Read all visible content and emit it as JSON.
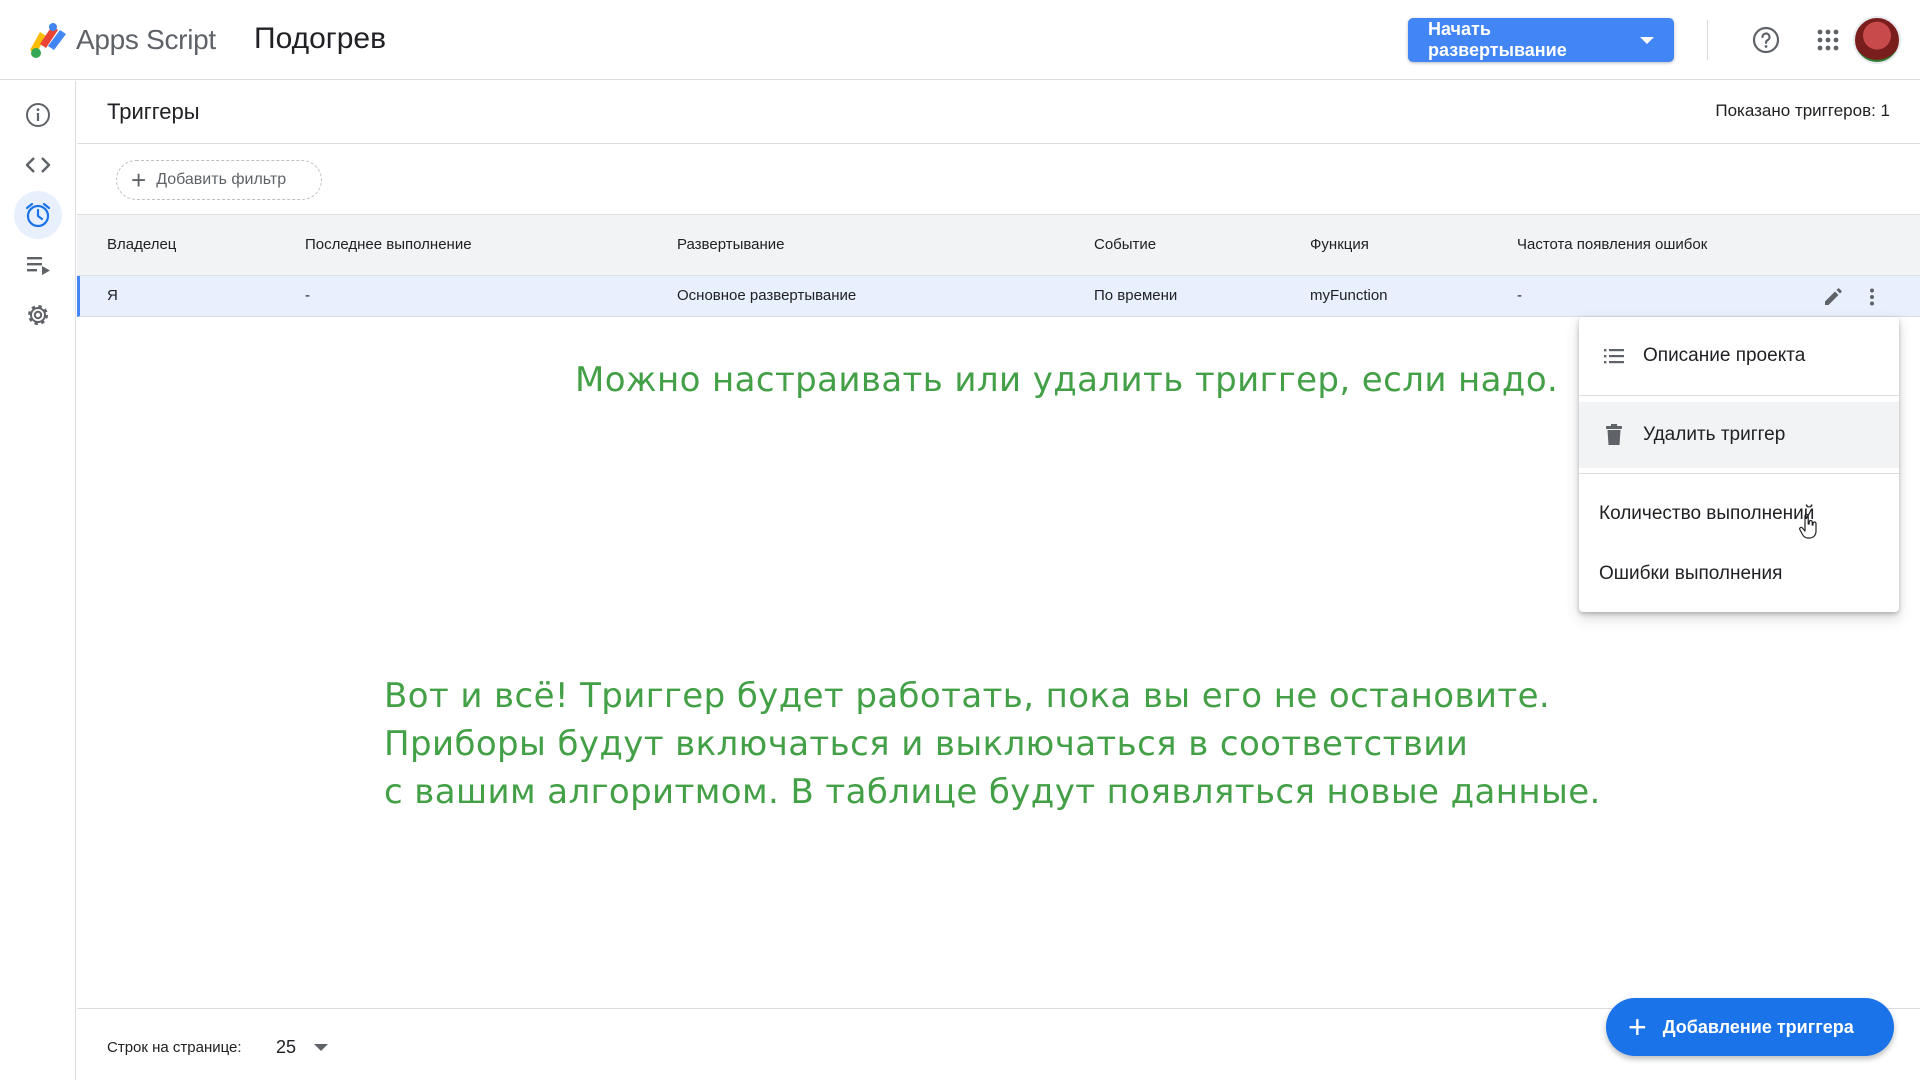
{
  "header": {
    "app_name": "Apps Script",
    "project_name": "Подогрев",
    "deploy_button": "Начать развертывание"
  },
  "rail": {
    "items": [
      "info-icon",
      "code-icon",
      "alarm-icon",
      "executions-icon",
      "settings-icon"
    ],
    "active": "alarm-icon"
  },
  "page": {
    "title": "Триггеры",
    "shown_count": "Показано триггеров: 1",
    "add_filter": "Добавить фильтр"
  },
  "table": {
    "columns": [
      "Владелец",
      "Последнее выполнение",
      "Развертывание",
      "Событие",
      "Функция",
      "Частота появления ошибок"
    ],
    "rows": [
      [
        "Я",
        "-",
        "Основное развертывание",
        "По времени",
        "myFunction",
        "-"
      ]
    ]
  },
  "menu": {
    "items": [
      "Описание проекта",
      "Удалить триггер",
      "Количество выполнений",
      "Ошибки выполнения"
    ],
    "hovered": "Удалить триггер"
  },
  "footer": {
    "rows_per_page_label": "Строк на странице:",
    "rows_per_page_value": "25"
  },
  "fab": {
    "label": "Добавление триггера"
  },
  "annotations": {
    "note1": "Можно настраивать или удалить триггер, если надо.",
    "note2_line1": "Вот и всё! Триггер будет работать, пока вы его не остановите.",
    "note2_line2": "Приборы будут включаться и выключаться в соответствии",
    "note2_line3": "с вашим алгоритмом. В таблице будут появляться новые данные."
  },
  "colors": {
    "accent": "#1a73e8",
    "deploy": "#4285f4",
    "annotation": "#43a047",
    "row_highlight": "#e8f0fe"
  }
}
